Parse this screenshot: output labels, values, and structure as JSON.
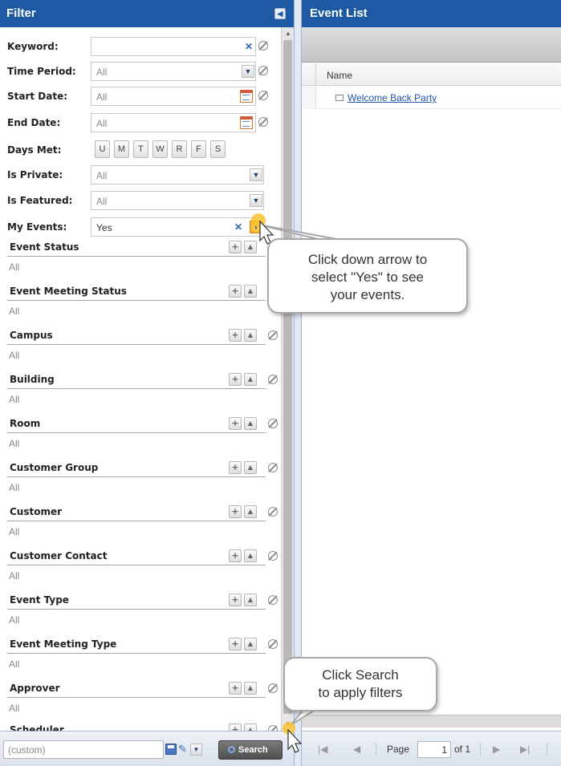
{
  "filter_panel": {
    "title": "Filter",
    "fields": {
      "keyword": {
        "label": "Keyword:",
        "value": ""
      },
      "time_period": {
        "label": "Time Period:",
        "value": "All"
      },
      "start_date": {
        "label": "Start Date:",
        "value": "All"
      },
      "end_date": {
        "label": "End Date:",
        "value": "All"
      },
      "days_met": {
        "label": "Days Met:",
        "days": [
          "U",
          "M",
          "T",
          "W",
          "R",
          "F",
          "S"
        ]
      },
      "is_private": {
        "label": "Is Private:",
        "value": "All"
      },
      "is_featured": {
        "label": "Is Featured:",
        "value": "All"
      },
      "my_events": {
        "label": "My Events:",
        "value": "Yes"
      }
    },
    "sections": [
      {
        "title": "Event Status",
        "value": "All"
      },
      {
        "title": "Event Meeting Status",
        "value": "All"
      },
      {
        "title": "Campus",
        "value": "All"
      },
      {
        "title": "Building",
        "value": "All"
      },
      {
        "title": "Room",
        "value": "All"
      },
      {
        "title": "Customer Group",
        "value": "All"
      },
      {
        "title": "Customer",
        "value": "All"
      },
      {
        "title": "Customer Contact",
        "value": "All"
      },
      {
        "title": "Event Type",
        "value": "All"
      },
      {
        "title": "Event Meeting Type",
        "value": "All"
      },
      {
        "title": "Approver",
        "value": "All"
      },
      {
        "title": "Scheduler",
        "value": ""
      }
    ],
    "footer": {
      "saved_filter_value": "(custom)",
      "search_label": "Search"
    }
  },
  "event_list": {
    "title": "Event List",
    "column_name": "Name",
    "rows": [
      {
        "name": "Welcome Back Party"
      }
    ],
    "pager": {
      "page_label": "Page",
      "page_value": "1",
      "of_label": "of 1"
    }
  },
  "callouts": {
    "my_events_tip": [
      "Click down arrow to",
      "select \"Yes\" to see",
      "your events."
    ],
    "search_tip": [
      "Click Search",
      "to apply filters"
    ]
  },
  "colors": {
    "header_blue": "#1e5aa3",
    "link": "#2255aa",
    "search_button": "#5a5a5a"
  }
}
